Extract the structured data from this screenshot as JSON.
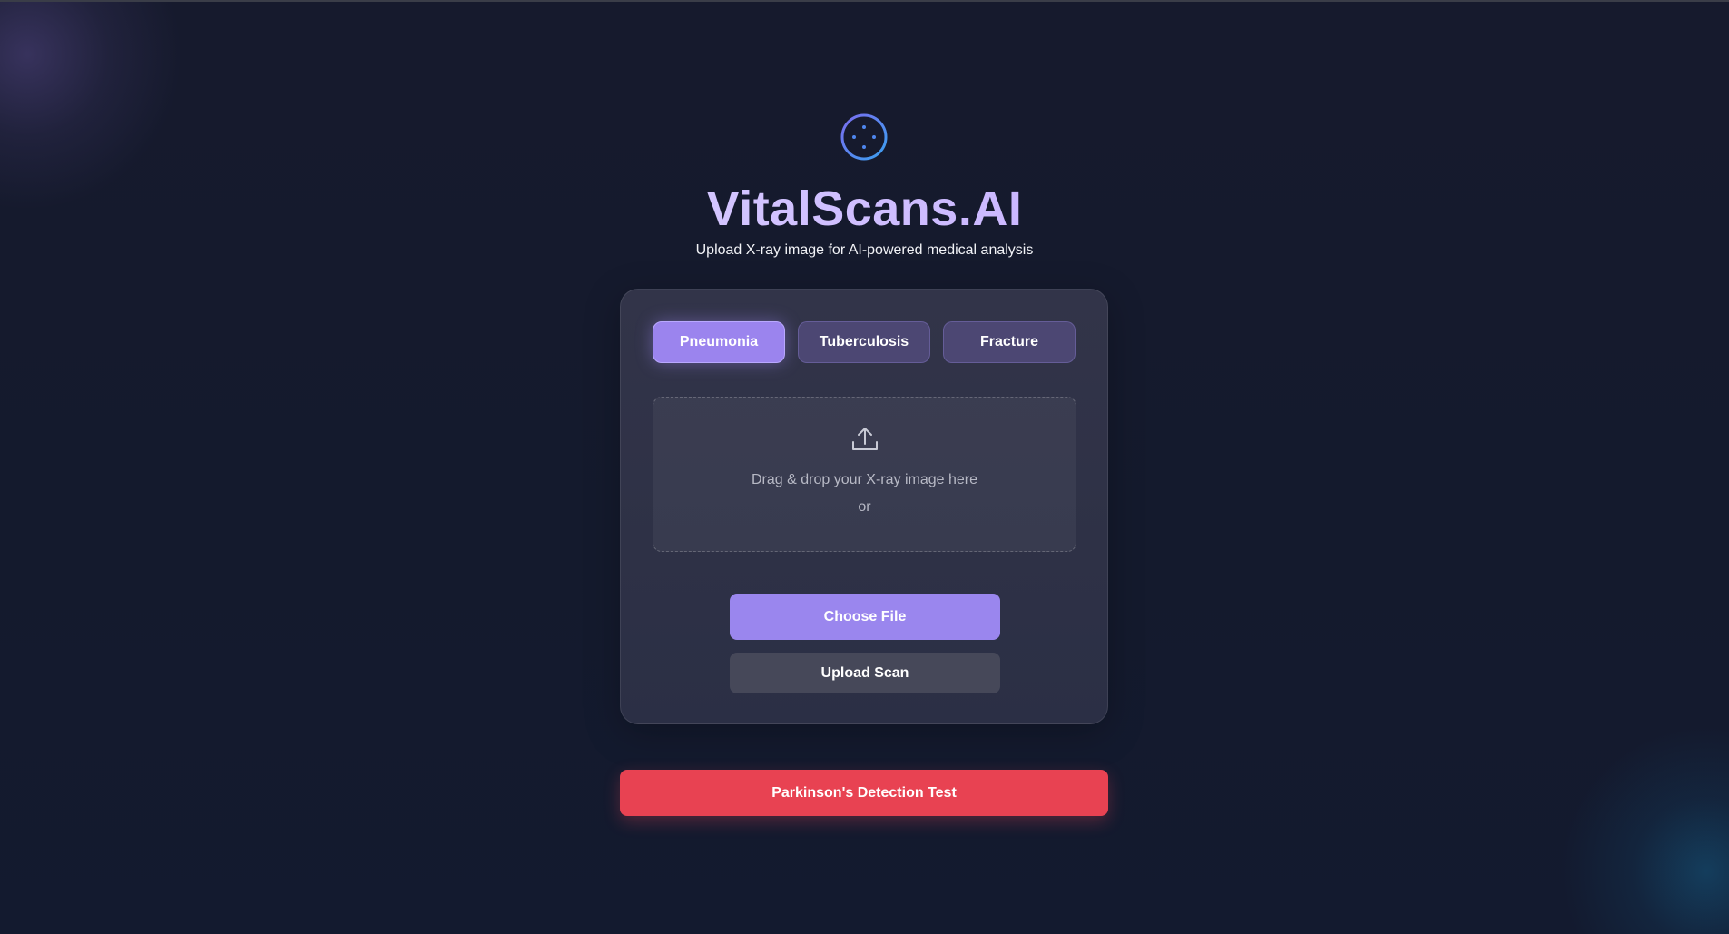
{
  "app": {
    "title": "VitalScans.AI",
    "subtitle": "Upload X-ray image for AI-powered medical analysis",
    "logo_icon": "scan-target-icon"
  },
  "tabs": [
    {
      "label": "Pneumonia",
      "active": true
    },
    {
      "label": "Tuberculosis",
      "active": false
    },
    {
      "label": "Fracture",
      "active": false
    }
  ],
  "dropzone": {
    "icon": "upload-icon",
    "text": "Drag & drop your X-ray image here",
    "or": "or"
  },
  "buttons": {
    "choose_file": "Choose File",
    "upload_scan": "Upload Scan",
    "parkinsons": "Parkinson's Detection Test"
  },
  "colors": {
    "accent": "#9b84ee",
    "danger": "#e84252",
    "background": "#151a2c"
  }
}
